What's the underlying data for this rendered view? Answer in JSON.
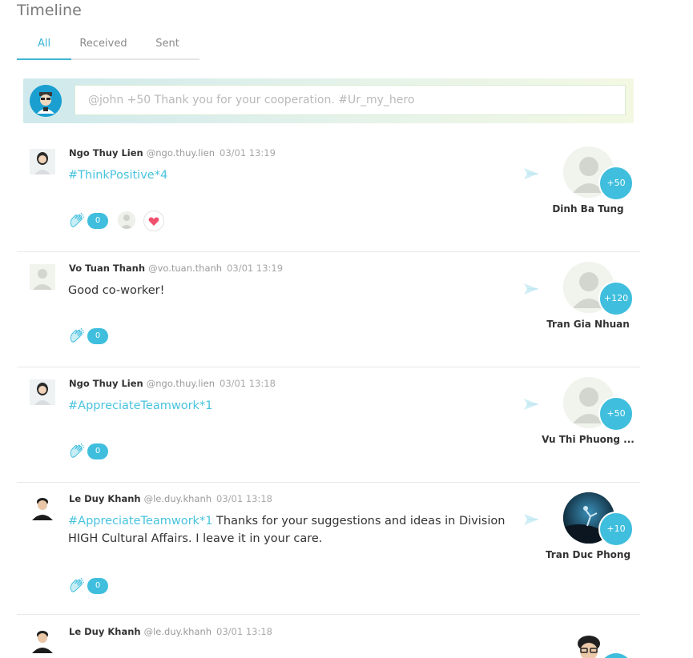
{
  "page": {
    "title": "Timeline"
  },
  "tabs": [
    {
      "label": "All",
      "active": true
    },
    {
      "label": "Received",
      "active": false
    },
    {
      "label": "Sent",
      "active": false
    }
  ],
  "composer": {
    "placeholder": "@john +50 Thank you for your cooperation. #Ur_my_hero"
  },
  "colors": {
    "accent": "#3fbedd",
    "tag": "#48c3de",
    "heart": "#f0506e"
  },
  "icons": {
    "clap": "clapping-hands-icon",
    "send": "send-arrow-icon",
    "heart": "heart-icon"
  },
  "posts": [
    {
      "sender": "Ngo Thuy Lien",
      "handle": "@ngo.thuy.lien",
      "time": "03/01 13:19",
      "tag": "#ThinkPositive*4",
      "text": "",
      "clap_count": "0",
      "has_reaction": true,
      "receiver": "Dinh Ba Tung",
      "points": "+50"
    },
    {
      "sender": "Vo Tuan Thanh",
      "handle": "@vo.tuan.thanh",
      "time": "03/01 13:19",
      "tag": "",
      "text": "Good co-worker!",
      "clap_count": "0",
      "has_reaction": false,
      "receiver": "Tran Gia Nhuan",
      "points": "+120"
    },
    {
      "sender": "Ngo Thuy Lien",
      "handle": "@ngo.thuy.lien",
      "time": "03/01 13:18",
      "tag": "#AppreciateTeamwork*1",
      "text": "",
      "clap_count": "0",
      "has_reaction": false,
      "receiver": "Vu Thi Phuong ...",
      "points": "+50"
    },
    {
      "sender": "Le Duy Khanh",
      "handle": "@le.duy.khanh",
      "time": "03/01 13:18",
      "tag": "#AppreciateTeamwork*1",
      "text": " Thanks for your suggestions and ideas in Division HIGH Cultural Affairs. I leave it in your care.",
      "clap_count": "0",
      "has_reaction": false,
      "receiver": "Tran Duc Phong",
      "points": "+10"
    },
    {
      "sender": "Le Duy Khanh",
      "handle": "@le.duy.khanh",
      "time": "03/01 13:18",
      "tag": "",
      "text": "",
      "clap_count": "",
      "has_reaction": false,
      "receiver": "",
      "points": ""
    }
  ]
}
